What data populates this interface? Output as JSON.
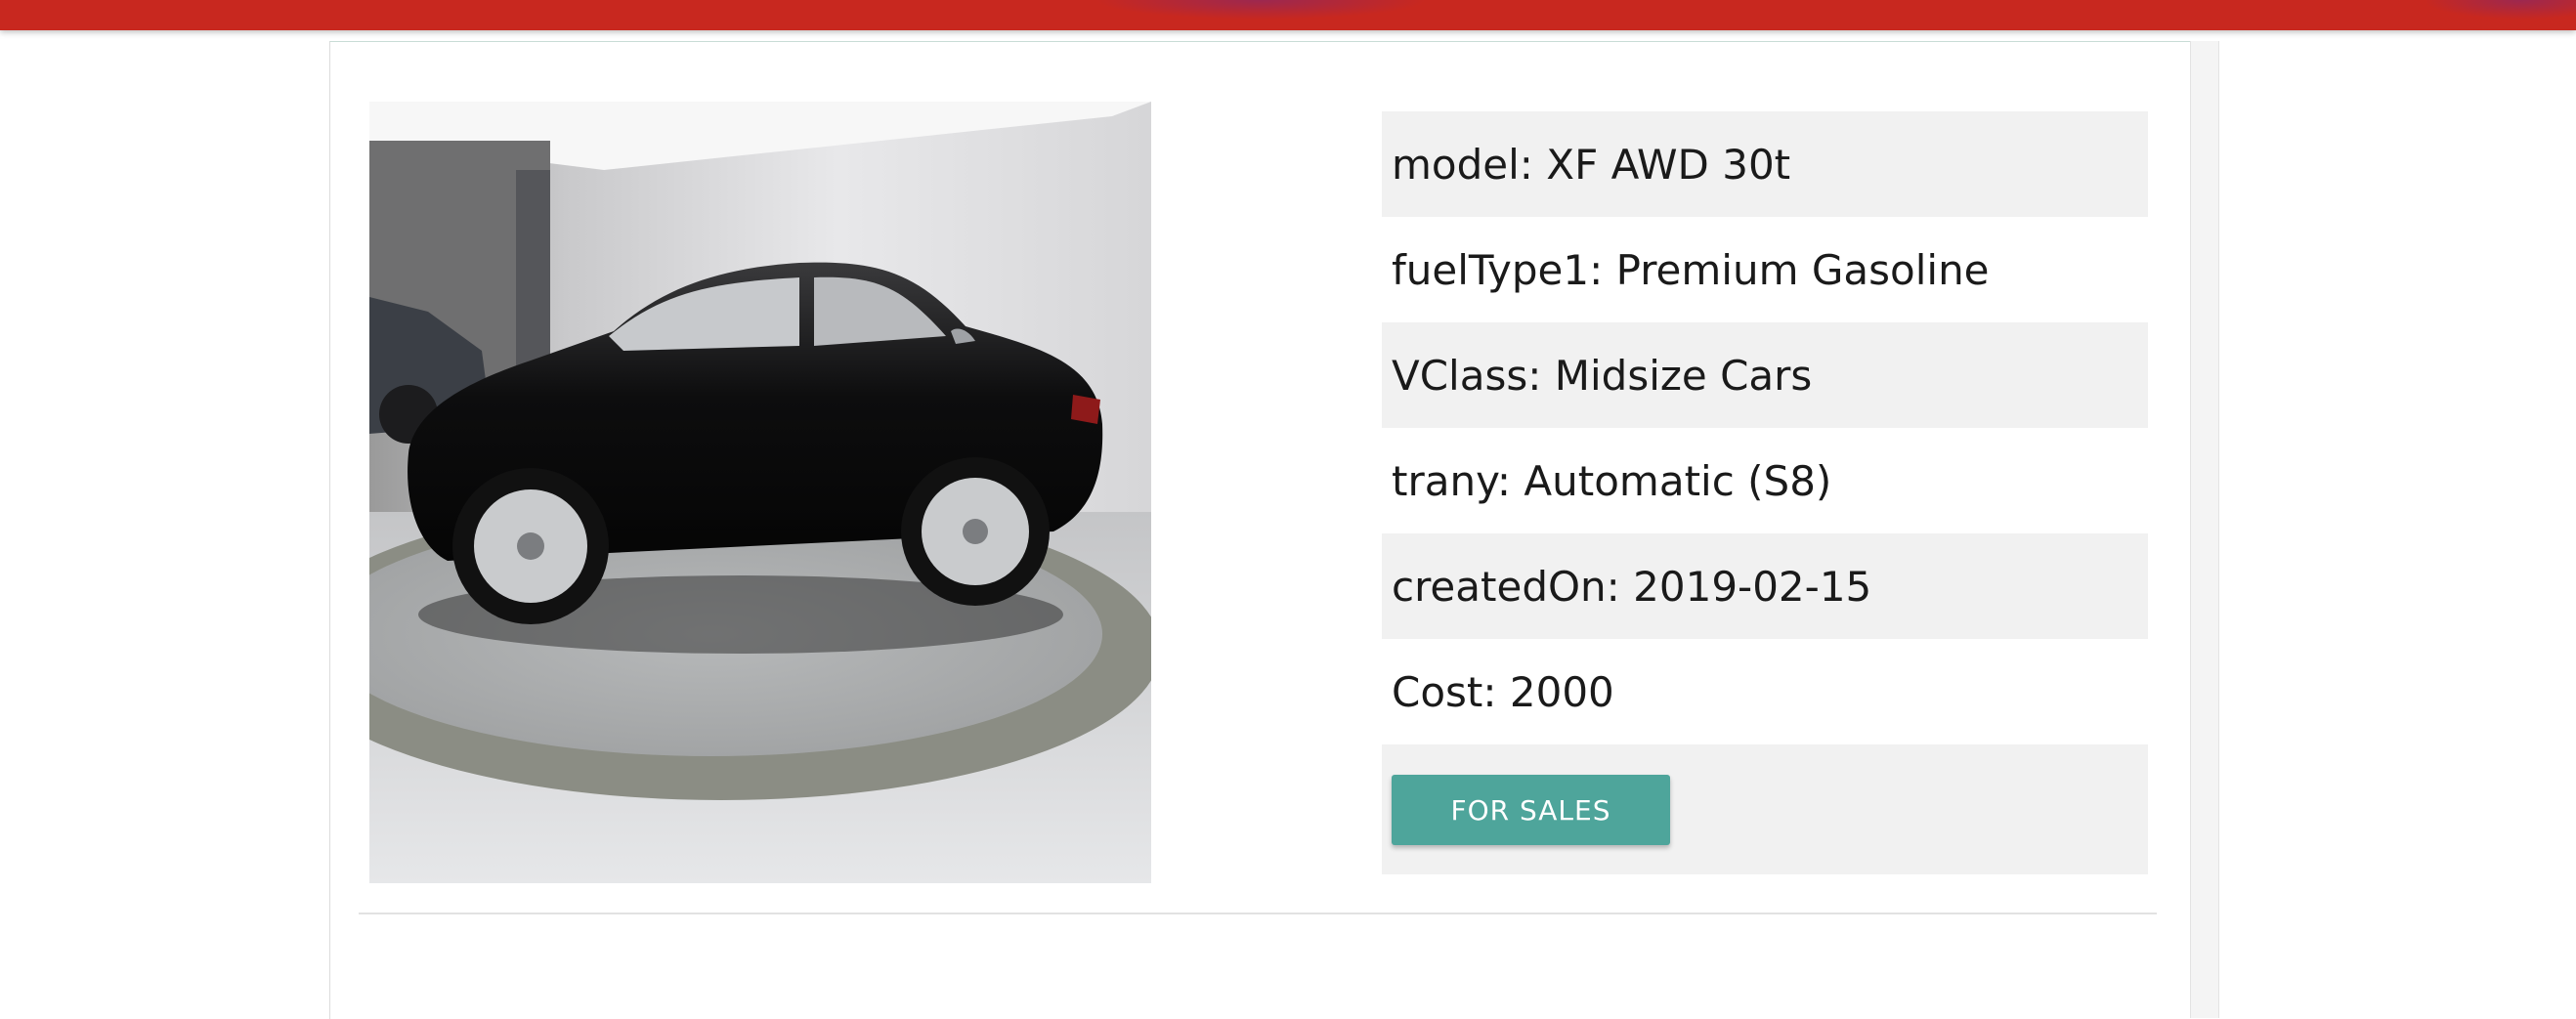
{
  "colors": {
    "topbar": "#c8281f",
    "button": "#4ea59b",
    "row_shade": "#f1f1f1"
  },
  "car": {
    "image_alt": "black-sedan-photo",
    "rows": [
      {
        "label": "model:",
        "value": "XF AWD 30t"
      },
      {
        "label": "fuelType1:",
        "value": "Premium Gasoline"
      },
      {
        "label": "VClass:",
        "value": "Midsize Cars"
      },
      {
        "label": "trany:",
        "value": "Automatic (S8)"
      },
      {
        "label": "createdOn:",
        "value": "2019-02-15"
      },
      {
        "label": "Cost:",
        "value": "2000"
      }
    ],
    "action_label": "FOR SALES"
  }
}
